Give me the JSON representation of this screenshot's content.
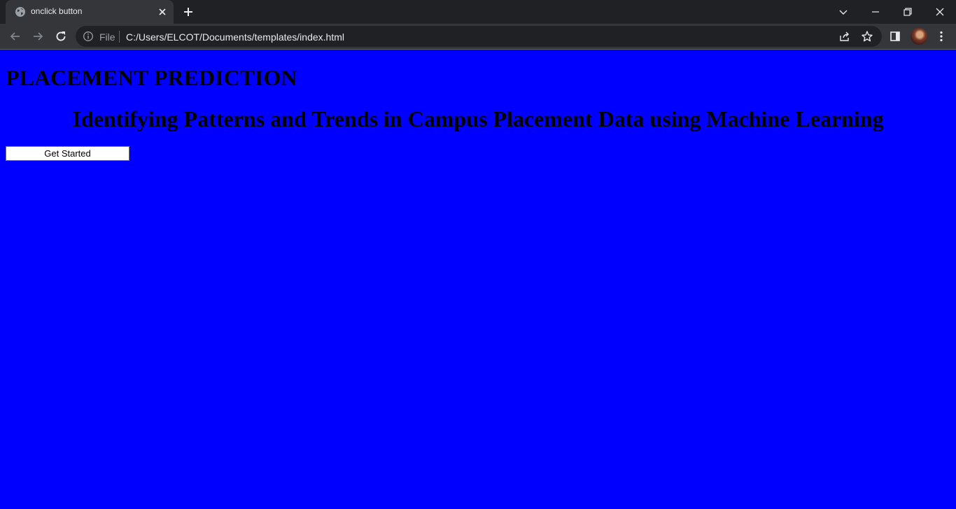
{
  "browser": {
    "tab": {
      "title": "onclick button"
    },
    "address_bar": {
      "scheme_label": "File",
      "url": "C:/Users/ELCOT/Documents/templates/index.html"
    }
  },
  "page": {
    "heading": "PLACEMENT PREDICTION",
    "subheading": "Identifying Patterns and Trends in Campus Placement Data using Machine Learning",
    "get_started": {
      "value": "Get Started"
    }
  },
  "colors": {
    "page_background": "#0000ff",
    "tabbar": "#202124",
    "toolbar": "#35363a"
  }
}
